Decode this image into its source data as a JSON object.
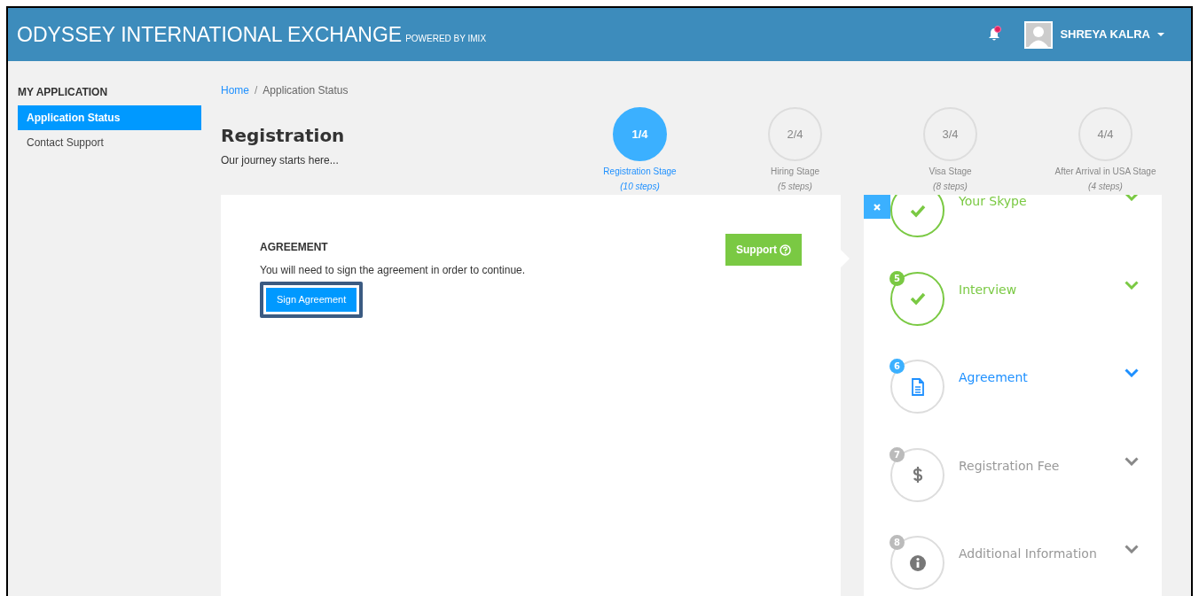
{
  "header": {
    "title": "ODYSSEY INTERNATIONAL EXCHANGE",
    "subtitle": "POWERED BY IMIX",
    "notification_unread": true,
    "user": "SHREYA KALRA"
  },
  "sidebar": {
    "heading": "MY APPLICATION",
    "items": [
      {
        "label": "Application Status",
        "selected": true
      },
      {
        "label": "Contact Support",
        "selected": false
      }
    ]
  },
  "breadcrumb": {
    "separator": "/",
    "items": [
      {
        "label": "Home",
        "kind": "link"
      },
      {
        "label": "Application Status",
        "kind": "current"
      }
    ]
  },
  "page": {
    "title": "Registration",
    "subtitle": "Our journey starts here..."
  },
  "stages": [
    {
      "number": "1/4",
      "label": "Registration Stage",
      "steps": "(10 steps)",
      "selected": true
    },
    {
      "number": "2/4",
      "label": "Hiring Stage",
      "steps": "(5 steps)",
      "selected": false
    },
    {
      "number": "3/4",
      "label": "Visa Stage",
      "steps": "(8 steps)",
      "selected": false
    },
    {
      "number": "4/4",
      "label": "After Arrival in USA Stage",
      "steps": "(4 steps)",
      "selected": false
    }
  ],
  "content": {
    "heading": "AGREEMENT",
    "support_button": "Support",
    "message": "You will need to sign the agreement in order to continue.",
    "action_button": "Sign Agreement"
  },
  "steps": [
    {
      "label": "Your Skype",
      "completed": true,
      "current": false,
      "kind": "check"
    },
    {
      "number": "5",
      "label": "Interview",
      "completed": true,
      "current": false,
      "kind": "check"
    },
    {
      "number": "6",
      "label": "Agreement",
      "completed": false,
      "current": true,
      "kind": "document"
    },
    {
      "number": "7",
      "label": "Registration Fee",
      "completed": false,
      "current": false,
      "kind": "dollar"
    },
    {
      "number": "8",
      "label": "Additional Information",
      "completed": false,
      "current": false,
      "kind": "info"
    }
  ]
}
